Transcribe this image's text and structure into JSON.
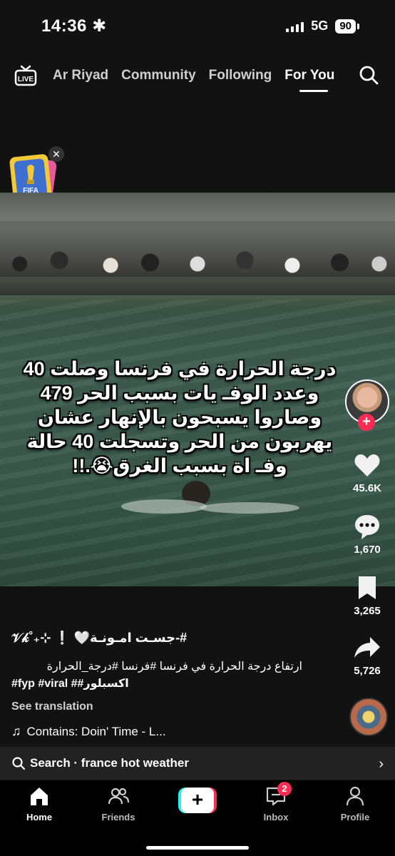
{
  "status_bar": {
    "time": "14:36",
    "time_icon": "asterisk-icon",
    "network": "5G",
    "battery": "90"
  },
  "top_nav": {
    "tabs": [
      {
        "label": "Ar Riyad",
        "active": false
      },
      {
        "label": "Community",
        "active": false
      },
      {
        "label": "Following",
        "active": false
      },
      {
        "label": "For You",
        "active": true
      }
    ]
  },
  "video": {
    "overlay_text": "درجة الحرارة في فرنسا وصلت 40\nوعدد الوفـ يات بسبب الحر 479\nوصاروا يسبحون بالإنهار عشان\nيهربون من الحر وتسجلت 40 حالة\nوفـ اة بسبب الغرق😭.!!"
  },
  "actions": {
    "likes": "45.6K",
    "comments": "1,670",
    "saves": "3,265",
    "shares": "5,726"
  },
  "caption": {
    "username": "#-جسـت امـونـة🤍 ❕ ⊹₊˚𝒱𝓀",
    "line1": "ارتفاع درجة الحرارة في فرنسا #فرنسا #درجة_الحرارة",
    "line2": "#fyp #viral ##اكسبلور",
    "see_translation": "See translation",
    "music": "Contains: Doin' Time - L..."
  },
  "search_bar": {
    "text": "Search · france hot weather"
  },
  "bottom_nav": {
    "items": [
      {
        "label": "Home",
        "active": true
      },
      {
        "label": "Friends",
        "active": false
      },
      {
        "label": "Inbox",
        "active": false,
        "badge": "2"
      },
      {
        "label": "Profile",
        "active": false
      }
    ]
  },
  "colors": {
    "accent": "#fe2c55",
    "accent_cyan": "#25f4ee",
    "background": "#121212"
  }
}
